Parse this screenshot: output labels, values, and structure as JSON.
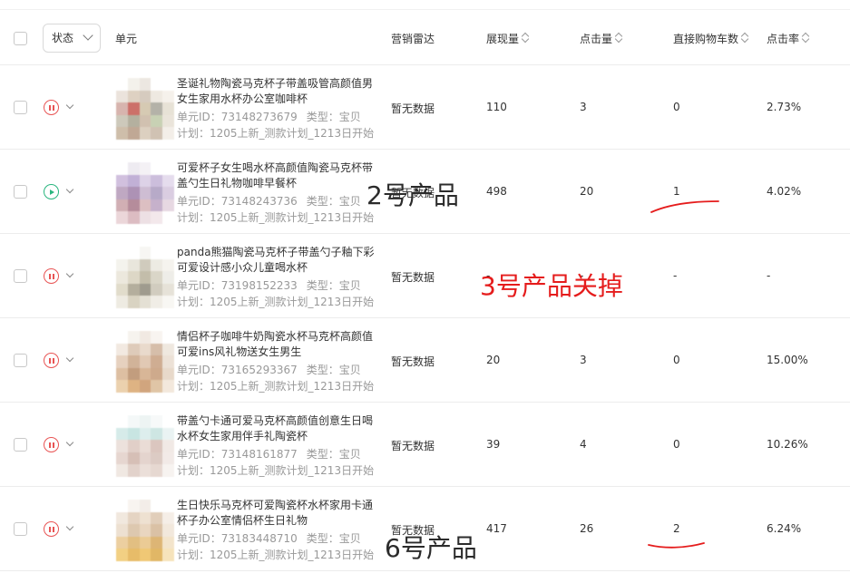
{
  "header": {
    "status_label": "状态",
    "unit_label": "单元",
    "radar_label": "营销雷达",
    "impressions_label": "展现量",
    "clicks_label": "点击量",
    "cart_label": "直接购物车数",
    "ctr_label": "点击率"
  },
  "rows": [
    {
      "status": "paused",
      "title": "圣诞礼物陶瓷马克杯子带盖吸管高颜值男女生家用水杯办公室咖啡杯",
      "unit_id": "单元ID：73148273679",
      "type": "类型：宝贝",
      "plan": "计划：1205上新_测款计划_1213日开始",
      "radar": "暂无数据",
      "impressions": "110",
      "clicks": "3",
      "cart": "0",
      "ctr": "2.73%",
      "thumb_colors": [
        "#ffffff",
        "#f2efe8",
        "#e9e3dc",
        "#ffffff",
        "#ffffff",
        "#e8dfd6",
        "#d9c9b8",
        "#cfc3b4",
        "#ece6dc",
        "#f4efe8",
        "#d1a8a0",
        "#c4584f",
        "#cfc1a6",
        "#a7a59a",
        "#e3ddd0",
        "#c5c0b0",
        "#a8a38f",
        "#cab7a3",
        "#bfc9a8",
        "#e7e0d4",
        "#c6b39c",
        "#b69a83",
        "#d6c8b6",
        "#c8b8a6",
        "#f1ece5"
      ]
    },
    {
      "status": "playing",
      "title": "可爱杯子女生喝水杯高颜值陶瓷马克杯带盖勺生日礼物咖啡早餐杯",
      "unit_id": "单元ID：73148243736",
      "type": "类型：宝贝",
      "plan": "计划：1205上新_测款计划_1213日开始",
      "radar": "暂无数据",
      "impressions": "498",
      "clicks": "20",
      "cart": "1",
      "ctr": "4.02%",
      "thumb_colors": [
        "#ffffff",
        "#ece8ef",
        "#f3eff4",
        "#ffffff",
        "#ffffff",
        "#c9b6d9",
        "#b7a3cf",
        "#d8cbe3",
        "#c4b3d6",
        "#e1d6ea",
        "#b59ab8",
        "#9f7fa9",
        "#c6b2cc",
        "#ab9cbf",
        "#d4c5dc",
        "#c9a2a7",
        "#a9798a",
        "#d7b4b8",
        "#bda4c3",
        "#e3d2dd",
        "#e8cfd3",
        "#d6b1b8",
        "#eadbe0",
        "#f1e4e8",
        "#ffffff"
      ]
    },
    {
      "status": "paused",
      "title": "panda熊猫陶瓷马克杯子带盖勺子釉下彩可爱设计感小众儿童喝水杯",
      "unit_id": "单元ID：73198152233",
      "type": "类型：宝贝",
      "plan": "计划：1205上新_测款计划_1213日开始",
      "radar": "暂无数据",
      "impressions": "-",
      "clicks": "-",
      "cart": "-",
      "ctr": "-",
      "thumb_colors": [
        "#ffffff",
        "#ffffff",
        "#f6f5f1",
        "#ffffff",
        "#ffffff",
        "#f3f1ea",
        "#e6e2d6",
        "#c8c3b2",
        "#ebe8df",
        "#f4f2ec",
        "#e9e5d8",
        "#d8d1bd",
        "#b9b29c",
        "#d4cfbf",
        "#ecebe4",
        "#dcd6c3",
        "#a7a08c",
        "#8f8a7b",
        "#c9c4b4",
        "#e2ded2",
        "#ece8dd",
        "#d3ccb8",
        "#e0dbcd",
        "#eeebe2",
        "#f7f6f1"
      ]
    },
    {
      "status": "paused",
      "title": "情侣杯子咖啡牛奶陶瓷水杯马克杯高颜值可爱ins风礼物送女生男生",
      "unit_id": "单元ID：73165293367",
      "type": "类型：宝贝",
      "plan": "计划：1205上新_测款计划_1213日开始",
      "radar": "暂无数据",
      "impressions": "20",
      "clicks": "3",
      "cart": "0",
      "ctr": "15.00%",
      "thumb_colors": [
        "#ffffff",
        "#f5f1ec",
        "#efe6dd",
        "#f7f3ee",
        "#ffffff",
        "#f0e6dc",
        "#d9c2ae",
        "#e6d4c4",
        "#cfb39c",
        "#ede4da",
        "#e2c9b4",
        "#c9a688",
        "#dcc0a8",
        "#c79f80",
        "#e9dccf",
        "#d8b492",
        "#b88c68",
        "#d2aa86",
        "#c69c78",
        "#e4d3c1",
        "#e8c9a0",
        "#d9a66e",
        "#ca9668",
        "#dbbb97",
        "#f1e5d6"
      ]
    },
    {
      "status": "paused",
      "title": "带盖勺卡通可爱马克杯高颜值创意生日喝水杯女生家用伴手礼陶瓷杯",
      "unit_id": "单元ID：73148161877",
      "type": "类型：宝贝",
      "plan": "计划：1205上新_测款计划_1213日开始",
      "radar": "暂无数据",
      "impressions": "39",
      "clicks": "4",
      "cart": "0",
      "ctr": "10.26%",
      "thumb_colors": [
        "#ffffff",
        "#f3f7f7",
        "#eaf3f2",
        "#f6f9f9",
        "#ffffff",
        "#cfe8e6",
        "#bfe1de",
        "#d8ecea",
        "#c6e2df",
        "#e7f2f1",
        "#e9dcd6",
        "#dcc7bf",
        "#e7d6cf",
        "#d5bdb4",
        "#efe6e1",
        "#e2cfc8",
        "#cfb4aa",
        "#e0cdc6",
        "#d7c2ba",
        "#f0e7e3",
        "#eee4de",
        "#ddcbc2",
        "#e8dad3",
        "#e2d2ca",
        "#f6f1ee"
      ]
    },
    {
      "status": "paused",
      "title": "生日快乐马克杯可爱陶瓷杯水杯家用卡通杯子办公室情侣杯生日礼物",
      "unit_id": "单元ID：73183448710",
      "type": "类型：宝贝",
      "plan": "计划：1205上新_测款计划_1213日开始",
      "radar": "暂无数据",
      "impressions": "417",
      "clicks": "26",
      "cart": "2",
      "ctr": "6.24%",
      "thumb_colors": [
        "#ffffff",
        "#f7f3ee",
        "#f1ebe4",
        "#ffffff",
        "#ffffff",
        "#efe4d9",
        "#e1cdb9",
        "#ecdcca",
        "#dcc6af",
        "#f4ece3",
        "#eadbc9",
        "#d8bfa2",
        "#e6d0b6",
        "#d4b796",
        "#f0e4d6",
        "#e9c790",
        "#ddb46d",
        "#e8c383",
        "#d8a95e",
        "#f2e0c2",
        "#f0c86e",
        "#e3b14f",
        "#eebf5d",
        "#dcab4c",
        "#f5dfb0"
      ]
    }
  ],
  "annotations": {
    "product_2": "2号产品",
    "product_3": "3号产品关掉",
    "product_6": "6号产品"
  },
  "colors": {
    "paused": "#e85454",
    "playing": "#29b57e",
    "annotation_red": "#e51c1c"
  }
}
